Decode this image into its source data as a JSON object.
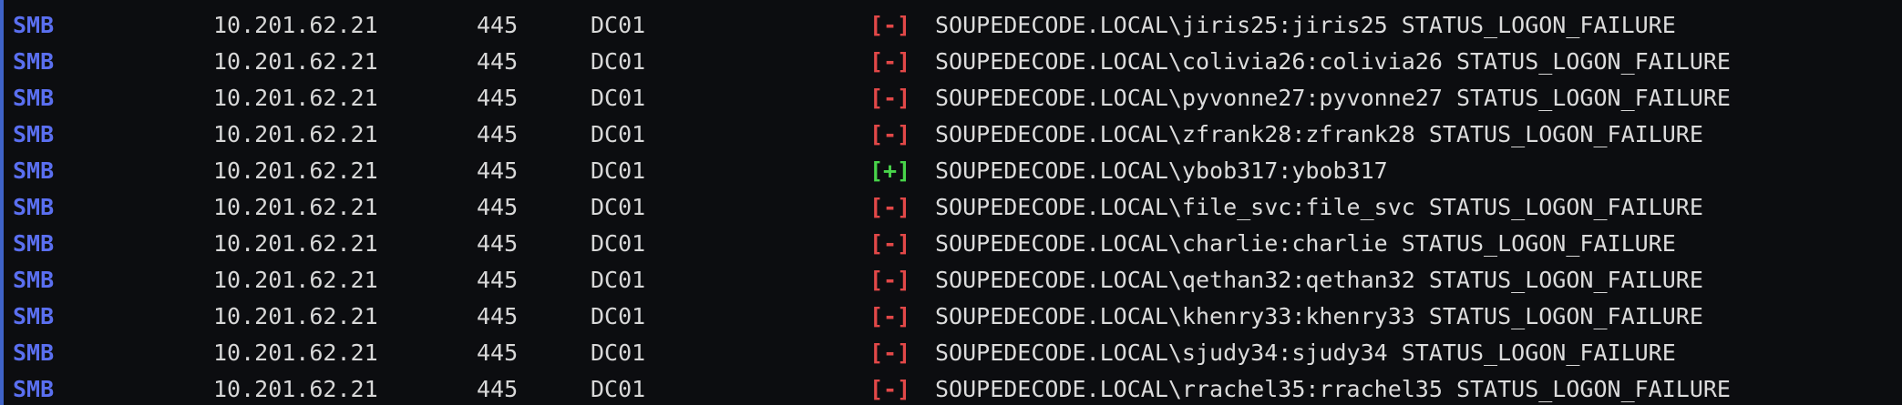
{
  "terminal": {
    "rows": [
      {
        "proto": "SMB",
        "ip": "10.201.62.21",
        "port": "445",
        "host": "DC01",
        "status": "[-]",
        "result": "fail",
        "message": "SOUPEDECODE.LOCAL\\jiris25:jiris25 STATUS_LOGON_FAILURE"
      },
      {
        "proto": "SMB",
        "ip": "10.201.62.21",
        "port": "445",
        "host": "DC01",
        "status": "[-]",
        "result": "fail",
        "message": "SOUPEDECODE.LOCAL\\colivia26:colivia26 STATUS_LOGON_FAILURE"
      },
      {
        "proto": "SMB",
        "ip": "10.201.62.21",
        "port": "445",
        "host": "DC01",
        "status": "[-]",
        "result": "fail",
        "message": "SOUPEDECODE.LOCAL\\pyvonne27:pyvonne27 STATUS_LOGON_FAILURE"
      },
      {
        "proto": "SMB",
        "ip": "10.201.62.21",
        "port": "445",
        "host": "DC01",
        "status": "[-]",
        "result": "fail",
        "message": "SOUPEDECODE.LOCAL\\zfrank28:zfrank28 STATUS_LOGON_FAILURE"
      },
      {
        "proto": "SMB",
        "ip": "10.201.62.21",
        "port": "445",
        "host": "DC01",
        "status": "[+]",
        "result": "success",
        "message": "SOUPEDECODE.LOCAL\\ybob317:ybob317"
      },
      {
        "proto": "SMB",
        "ip": "10.201.62.21",
        "port": "445",
        "host": "DC01",
        "status": "[-]",
        "result": "fail",
        "message": "SOUPEDECODE.LOCAL\\file_svc:file_svc STATUS_LOGON_FAILURE"
      },
      {
        "proto": "SMB",
        "ip": "10.201.62.21",
        "port": "445",
        "host": "DC01",
        "status": "[-]",
        "result": "fail",
        "message": "SOUPEDECODE.LOCAL\\charlie:charlie STATUS_LOGON_FAILURE"
      },
      {
        "proto": "SMB",
        "ip": "10.201.62.21",
        "port": "445",
        "host": "DC01",
        "status": "[-]",
        "result": "fail",
        "message": "SOUPEDECODE.LOCAL\\qethan32:qethan32 STATUS_LOGON_FAILURE"
      },
      {
        "proto": "SMB",
        "ip": "10.201.62.21",
        "port": "445",
        "host": "DC01",
        "status": "[-]",
        "result": "fail",
        "message": "SOUPEDECODE.LOCAL\\khenry33:khenry33 STATUS_LOGON_FAILURE"
      },
      {
        "proto": "SMB",
        "ip": "10.201.62.21",
        "port": "445",
        "host": "DC01",
        "status": "[-]",
        "result": "fail",
        "message": "SOUPEDECODE.LOCAL\\sjudy34:sjudy34 STATUS_LOGON_FAILURE"
      },
      {
        "proto": "SMB",
        "ip": "10.201.62.21",
        "port": "445",
        "host": "DC01",
        "status": "[-]",
        "result": "fail",
        "message": "SOUPEDECODE.LOCAL\\rrachel35:rrachel35 STATUS_LOGON_FAILURE"
      }
    ]
  },
  "colors": {
    "background": "#0c0d10",
    "protocol": "#5a6ff0",
    "failure": "#e24848",
    "success": "#48d44a",
    "text": "#dcdcdc"
  }
}
